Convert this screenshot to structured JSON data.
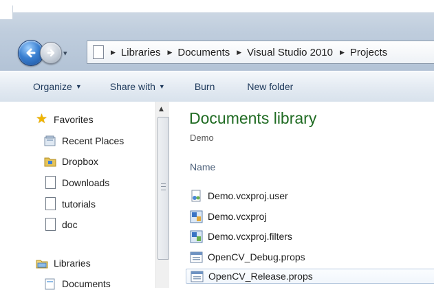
{
  "address_bar": {
    "crumbs": [
      "Libraries",
      "Documents",
      "Visual Studio 2010",
      "Projects"
    ]
  },
  "toolbar": {
    "organize": "Organize",
    "share_with": "Share with",
    "burn": "Burn",
    "new_folder": "New folder"
  },
  "nav_pane": {
    "favorites": "Favorites",
    "recent_places": "Recent Places",
    "dropbox": "Dropbox",
    "downloads": "Downloads",
    "tutorials": "tutorials",
    "doc": "doc",
    "libraries": "Libraries",
    "documents": "Documents"
  },
  "main": {
    "title": "Documents library",
    "subtitle": "Demo",
    "column_name": "Name",
    "files": [
      {
        "name": "Demo.vcxproj.user",
        "icon": "user-file-icon"
      },
      {
        "name": "Demo.vcxproj",
        "icon": "vcxproj-file-icon"
      },
      {
        "name": "Demo.vcxproj.filters",
        "icon": "filters-file-icon"
      },
      {
        "name": "OpenCV_Debug.props",
        "icon": "props-file-icon"
      },
      {
        "name": "OpenCV_Release.props",
        "icon": "props-file-icon",
        "selected": true
      }
    ]
  },
  "colors": {
    "library_title": "#1f6b22",
    "toolbar_text": "#1e395b",
    "selection_border": "#b5c7de"
  }
}
